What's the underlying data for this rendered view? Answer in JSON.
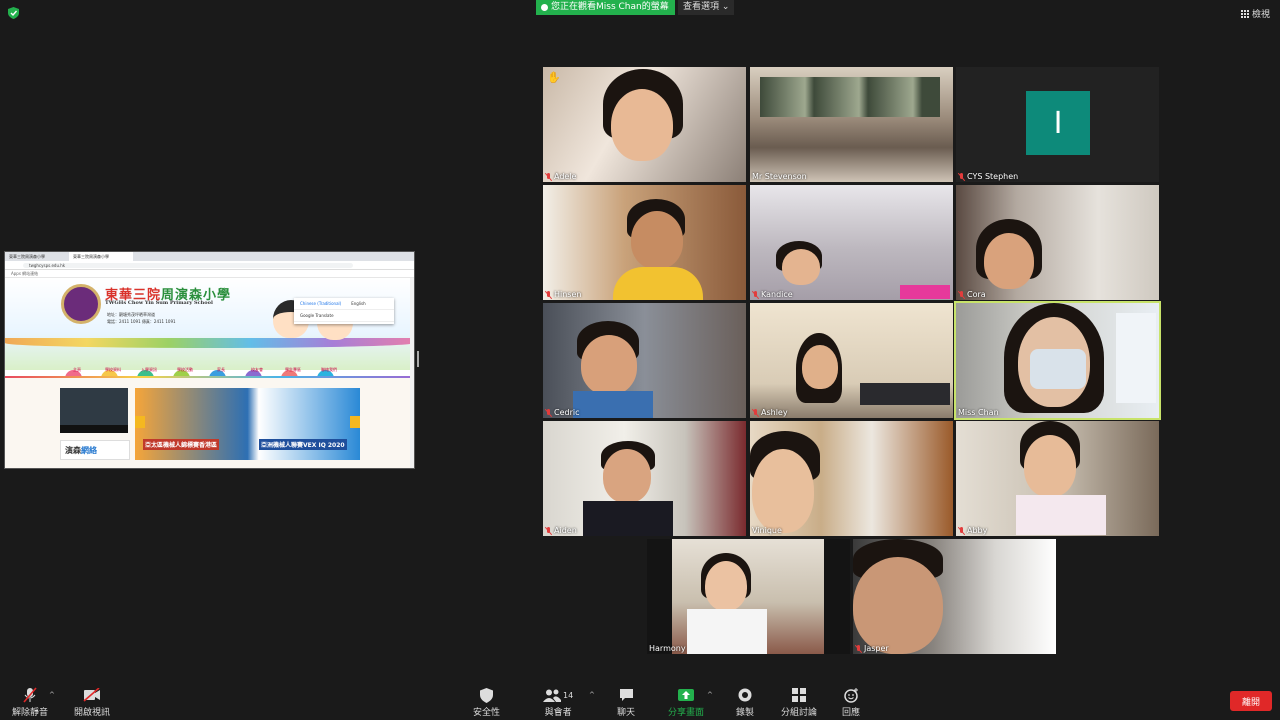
{
  "top_bar": {
    "share_banner": "您正在觀看Miss Chan的螢幕",
    "view_options": "查看選項",
    "view_toggle": "檢視"
  },
  "shared_screen": {
    "tabs": [
      "東華三院周演森小學",
      "東華三院周演森小學"
    ],
    "url": "twghcysps.edu.hk",
    "bookmarks": "Apps   網站連結",
    "site_title_red": "東華三院",
    "site_title_green": "周演森小學",
    "site_subtitle": "TWGHs Chow Yin Sum Primary School",
    "contact_lines": [
      "地址：觀塘秀茂坪晒草灣道",
      "電話：2411 1091   傳真：2411 1091"
    ],
    "dropdown_options": [
      "Chinese (Traditional)",
      "English"
    ],
    "dropdown_footer": "Google Translate",
    "nav_items": [
      "主頁",
      "學校資料",
      "入學資訊",
      "學校活動",
      "家長",
      "校友會",
      "學生專區",
      "聯絡我們"
    ],
    "slide_caption_1": "亞太區機械人錦標賽香港區",
    "slide_caption_2": "亞洲機械人聯賽VEX IQ 2020",
    "contact_box_label_a": "演森",
    "contact_box_label_b": "網絡"
  },
  "participants": [
    {
      "name": "Adele",
      "muted": true,
      "raised_hand": true
    },
    {
      "name": "Mr Stevenson",
      "muted": false
    },
    {
      "name": "CYS Stephen",
      "muted": true,
      "avatar_letter": "I"
    },
    {
      "name": "Hinsen",
      "muted": true
    },
    {
      "name": "Kandice",
      "muted": true
    },
    {
      "name": "Cora",
      "muted": true
    },
    {
      "name": "Cedric",
      "muted": true
    },
    {
      "name": "Ashley",
      "muted": true
    },
    {
      "name": "Miss Chan",
      "muted": false,
      "active_speaker": true
    },
    {
      "name": "Aiden",
      "muted": true
    },
    {
      "name": "Vinique",
      "muted": false
    },
    {
      "name": "Abby",
      "muted": true
    },
    {
      "name": "Harmony",
      "muted": false
    },
    {
      "name": "Jasper",
      "muted": true
    }
  ],
  "toolbar": {
    "unmute": "解除靜音",
    "start_video": "開啟視訊",
    "security": "安全性",
    "participants": "與會者",
    "participant_count": "14",
    "chat": "聊天",
    "share_screen": "分享畫面",
    "record": "錄製",
    "breakout": "分組討論",
    "reactions": "回應",
    "end": "離開"
  },
  "colors": {
    "background": "#1a1a1a",
    "share_green": "#23b14d",
    "active_speaker_outline": "#c8e36a",
    "end_red": "#e02828",
    "avatar_teal": "#0d8a7a"
  }
}
